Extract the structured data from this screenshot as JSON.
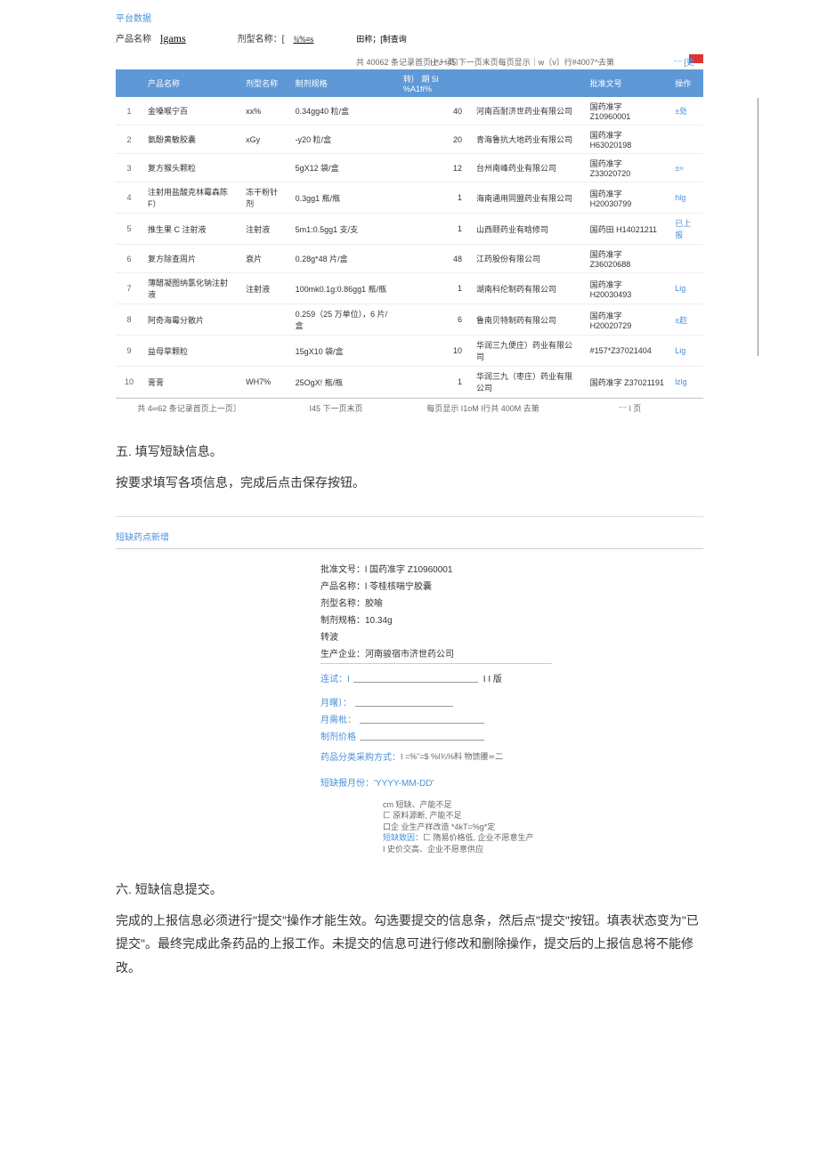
{
  "platform_label": "平台数据",
  "search": {
    "product_label": "产品名称",
    "product_value": "lgams",
    "dosage_label": "剂型名称：[",
    "dosage_value": "¾%≡s",
    "field_label": "田称；[制查询"
  },
  "pagination_top": {
    "left": "共 40062 条记录首页上一页〕",
    "right": "H²J I45 下一页末页每页显示｜w〔v〕行#4007^去第",
    "more": "⁻⁻ [更"
  },
  "table": {
    "headers": [
      "",
      "产品名称",
      "剂型名称",
      "制剂规格",
      "转｝ 期 5I %A1fí%",
      "",
      "批准文号",
      "操作"
    ],
    "rows": [
      {
        "idx": "1",
        "name": "金嗓喉宁百",
        "dosage": "xx%",
        "spec": "0.34gg40 粒/盒",
        "qty": "40",
        "mfr": "河南百耐济世药业有限公司",
        "approval": "国药准字 Z10960001",
        "op": "±处"
      },
      {
        "idx": "2",
        "name": "氨酚黄敏胶囊",
        "dosage": "xGy",
        "spec": "-y20 粒/盒",
        "qty": "20",
        "mfr": "青海鲁抗大地药业有限公司",
        "approval": "国药准字 H63020198",
        "op": ""
      },
      {
        "idx": "3",
        "name": "复方猴头颗粒",
        "dosage": "",
        "spec": "5gX12 袋/盒",
        "qty": "12",
        "mfr": "台州南峰药业有限公司",
        "approval": "国药准字 Z33020720",
        "op": "±≈"
      },
      {
        "idx": "4",
        "name": "注射用盐酸克林霉森陈 F）",
        "dosage": "冻干粉针剂",
        "spec": "0.3gg1 瓶/瓶",
        "qty": "1",
        "mfr": "海南通用同盟药业有限公司",
        "approval": "国药准字 H20030799",
        "op": "hlg"
      },
      {
        "idx": "5",
        "name": "推生果 C 注射液",
        "dosage": "注射液",
        "spec": "5m1:0.5gg1 支/支",
        "qty": "1",
        "mfr": "山西颐药业有晗修司",
        "approval": "国药田 H14021211",
        "op": "已上报"
      },
      {
        "idx": "6",
        "name": "复方除查周片",
        "dosage": "衰片",
        "spec": "0.28g*48 片/盒",
        "qty": "48",
        "mfr": "江药股份有限公司",
        "approval": "国药准字 Z36020688",
        "op": ""
      },
      {
        "idx": "7",
        "name": "薄醋凝图纳氯化钠注射液",
        "dosage": "注射液",
        "spec": "100mk0.1g:0.86gg1 瓶/瓶",
        "qty": "1",
        "mfr": "湖南科伦制药有限公司",
        "approval": "国药准字 H20030493",
        "op": "Lig"
      },
      {
        "idx": "8",
        "name": "阿奇海霉分散片",
        "dosage": "",
        "spec": "0.259（25 万单位），6 片/盒",
        "qty": "6",
        "mfr": "鲁南贝特制药有限公司",
        "approval": "国药准字 H20020729",
        "op": "±趁"
      },
      {
        "idx": "9",
        "name": "益母草颗粒",
        "dosage": "",
        "spec": "15gX10 袋/盒",
        "qty": "10",
        "mfr": "华润三九便庄）药业有限公司",
        "approval": "#157*Z37021404",
        "op": "Lig"
      },
      {
        "idx": "10",
        "name": "膏膏",
        "dosage": "WH7%",
        "spec": "25OgX! 瓶/瓶",
        "qty": "1",
        "mfr": "华润三九（枣庄）药业有限公司",
        "approval": "国药准字 Z37021191",
        "op": "lzlg"
      }
    ]
  },
  "pagination_bottom": {
    "c1": "共 4∞62 条记录首页上一页〕",
    "c2": "I45 下一页末页",
    "c3": "每页显示 I1oM l行共 400M 去第",
    "c4": "⁻⁻ l 页"
  },
  "section5": {
    "title": "五. 填写短缺信息。",
    "body": "按要求填写各项信息，完成后点击保存按钮。"
  },
  "form": {
    "heading": "短缺药点新增",
    "approval_label": "批准文号：l 国药准字 Z10960001",
    "product_label": "产品名称：l 苓桂核喘宁胶囊",
    "dosage_label": "剂型名称：胶喻",
    "spec_label": "制剂规格：10.34g",
    "transfer_label": "转波",
    "mfr_label": "生产企业：河南骏宿市济世药公司",
    "kucun_label": "连试：I",
    "kucun_btn": "I I 版",
    "yuejun_label": "月曙〕：",
    "yuexu_label": "月需枇：",
    "price_label": "制剂价格",
    "procure_label": "药品分类采购方式：",
    "procure_value": "I =%˜=$ %I¾%料 物馈腰⋍二",
    "date_label": "短缺报月份：'YYYY-MM-DD'",
    "reasons": [
      "cm 短缺、产能不足",
      "匚 原料源断, 产能不足",
      "口企 业生产样改造 *4kT=%g*定",
      "匚 隋易价格低, 企业不愿意生产",
      "I 史价交高、企业不愿意供应"
    ],
    "reason_label": "短缺致因："
  },
  "section6": {
    "title": "六. 短缺信息提交。",
    "body": "完成的上报信息必须进行\"提交\"操作才能生效。勾选要提交的信息条，然后点\"提交\"按钮。填表状态变为\"已提交\"。最终完成此条药品的上报工作。未提交的信息可进行修改和删除操作，提交后的上报信息将不能修改。"
  }
}
